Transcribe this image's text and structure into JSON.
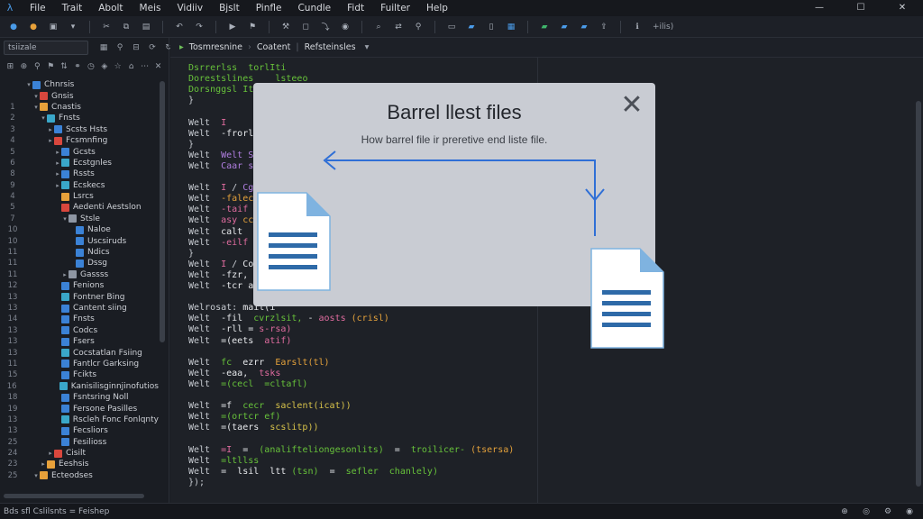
{
  "menu": {
    "app_icon": "lambda-icon",
    "items": [
      "File",
      "Trait",
      "Abolt",
      "Meis",
      "Vidiiv",
      "Bjslt",
      "Pinfle",
      "Cundle",
      "Fidt",
      "Fuilter",
      "Help"
    ],
    "window_controls": [
      "—",
      "☐",
      "✕"
    ]
  },
  "toolbar": {
    "label": "+ilis)"
  },
  "sidebar": {
    "search_value": "tsiizale",
    "tree": [
      {
        "num": "",
        "label": "Chnrsis",
        "icon": "blue",
        "depth": 0,
        "caret": "v"
      },
      {
        "num": "",
        "label": "Gnsis",
        "icon": "red",
        "depth": 1,
        "caret": "v"
      },
      {
        "num": "1",
        "label": "Cnastis",
        "icon": "orange",
        "depth": 1,
        "caret": "v"
      },
      {
        "num": "2",
        "label": "Fnsts",
        "icon": "teal",
        "depth": 2,
        "caret": "v"
      },
      {
        "num": "3",
        "label": "Scsts Hsts",
        "icon": "blue",
        "depth": 3,
        "caret": ">"
      },
      {
        "num": "4",
        "label": "Fcsmnfing",
        "icon": "red",
        "depth": 3,
        "caret": ">"
      },
      {
        "num": "5",
        "label": "Gcsts",
        "icon": "blue",
        "depth": 4,
        "caret": ">"
      },
      {
        "num": "6",
        "label": "Ecstgnles",
        "icon": "teal",
        "depth": 4,
        "caret": ">"
      },
      {
        "num": "8",
        "label": "Rssts",
        "icon": "blue",
        "depth": 4,
        "caret": ">"
      },
      {
        "num": "9",
        "label": "Ecskecs",
        "icon": "teal",
        "depth": 4,
        "caret": ">"
      },
      {
        "num": "4",
        "label": "Lsrcs",
        "icon": "orange",
        "depth": 4,
        "caret": ""
      },
      {
        "num": "5",
        "label": "Aedenti Aestslon",
        "icon": "red",
        "depth": 4,
        "caret": ""
      },
      {
        "num": "7",
        "label": "Stsle",
        "icon": "gray",
        "depth": 5,
        "caret": "v"
      },
      {
        "num": "10",
        "label": "Naloe",
        "icon": "blue",
        "depth": 6,
        "caret": ""
      },
      {
        "num": "10",
        "label": "Uscsiruds",
        "icon": "blue",
        "depth": 6,
        "caret": ""
      },
      {
        "num": "11",
        "label": "Ndics",
        "icon": "blue",
        "depth": 6,
        "caret": ""
      },
      {
        "num": "11",
        "label": "Dssg",
        "icon": "blue",
        "depth": 6,
        "caret": ""
      },
      {
        "num": "11",
        "label": "Gassss",
        "icon": "gray",
        "depth": 5,
        "caret": ">"
      },
      {
        "num": "12",
        "label": "Fenions",
        "icon": "blue",
        "depth": 4,
        "caret": ""
      },
      {
        "num": "13",
        "label": "Fontner Bing",
        "icon": "teal",
        "depth": 4,
        "caret": ""
      },
      {
        "num": "13",
        "label": "Cantent siing",
        "icon": "blue",
        "depth": 4,
        "caret": ""
      },
      {
        "num": "14",
        "label": "Fnsts",
        "icon": "blue",
        "depth": 4,
        "caret": ""
      },
      {
        "num": "13",
        "label": "Codcs",
        "icon": "blue",
        "depth": 4,
        "caret": ""
      },
      {
        "num": "13",
        "label": "Fsers",
        "icon": "blue",
        "depth": 4,
        "caret": ""
      },
      {
        "num": "13",
        "label": "Cocstatlan Fsiing",
        "icon": "teal",
        "depth": 4,
        "caret": ""
      },
      {
        "num": "11",
        "label": "Fantlcr Garksing",
        "icon": "blue",
        "depth": 4,
        "caret": ""
      },
      {
        "num": "15",
        "label": "Fcikts",
        "icon": "blue",
        "depth": 4,
        "caret": ""
      },
      {
        "num": "16",
        "label": "Kanisilisginnjinofutios",
        "icon": "teal",
        "depth": 4,
        "caret": ""
      },
      {
        "num": "18",
        "label": "Fsntsring Noll",
        "icon": "blue",
        "depth": 4,
        "caret": ""
      },
      {
        "num": "19",
        "label": "Fersone Pasilles",
        "icon": "blue",
        "depth": 4,
        "caret": ""
      },
      {
        "num": "13",
        "label": "Rscleh Fonc Fonlqnty",
        "icon": "teal",
        "depth": 4,
        "caret": ""
      },
      {
        "num": "13",
        "label": "Fecsliors",
        "icon": "blue",
        "depth": 4,
        "caret": ""
      },
      {
        "num": "25",
        "label": "Fesilioss",
        "icon": "blue",
        "depth": 4,
        "caret": ""
      },
      {
        "num": "24",
        "label": "Cisilt",
        "icon": "red",
        "depth": 3,
        "caret": ">"
      },
      {
        "num": "23",
        "label": "Eeshsis",
        "icon": "orange",
        "depth": 2,
        "caret": ">"
      },
      {
        "num": "25",
        "label": "Ecteodses",
        "icon": "orange",
        "depth": 1,
        "caret": "v"
      }
    ]
  },
  "editor": {
    "tab_path": [
      "Tosmresnine",
      "Coatent",
      "Refsteinsles"
    ],
    "lines": [
      [
        [
          "c-green",
          "Dsrrerlss  torlIti"
        ]
      ],
      [
        [
          "c-green",
          "Dorestslines"
        ],
        [
          "c-kw",
          "    "
        ],
        [
          "c-green",
          "lsteeo"
        ]
      ],
      [
        [
          "c-green",
          "Dorsnggsl Itfs"
        ]
      ],
      [
        [
          "c-kw",
          "}"
        ]
      ],
      [
        [
          "c-kw",
          ""
        ]
      ],
      [
        [
          "c-kw",
          "Welt  "
        ],
        [
          "c-pink",
          "I"
        ]
      ],
      [
        [
          "c-kw",
          "Welt  "
        ],
        [
          "c-white",
          "-frorl Iif"
        ]
      ],
      [
        [
          "c-kw",
          "}"
        ]
      ],
      [
        [
          "c-kw",
          "Welt  "
        ],
        [
          "c-purple",
          "Welt Stt(Is)"
        ]
      ],
      [
        [
          "c-kw",
          "Welt  "
        ],
        [
          "c-purple",
          "Caar scsht)"
        ]
      ],
      [
        [
          "c-kw",
          ""
        ]
      ],
      [
        [
          "c-kw",
          "Welt  "
        ],
        [
          "c-pink",
          "I"
        ],
        [
          "c-kw",
          " / "
        ],
        [
          "c-purple",
          "Cgrt"
        ]
      ],
      [
        [
          "c-kw",
          "Welt  "
        ],
        [
          "c-orange",
          "-falecre"
        ]
      ],
      [
        [
          "c-kw",
          "Welt  "
        ],
        [
          "c-pink",
          "-taif "
        ],
        [
          "c-orange",
          "Srs"
        ]
      ],
      [
        [
          "c-kw",
          "Welt  "
        ],
        [
          "c-pink",
          "asy "
        ],
        [
          "c-orange",
          "cc"
        ]
      ],
      [
        [
          "c-kw",
          "Welt  "
        ],
        [
          "c-white",
          "calt  cc"
        ]
      ],
      [
        [
          "c-kw",
          "Welt  "
        ],
        [
          "c-pink",
          "-eilf  ca"
        ]
      ],
      [
        [
          "c-kw",
          "}"
        ]
      ],
      [
        [
          "c-kw",
          "Welt  "
        ],
        [
          "c-pink",
          "I"
        ],
        [
          "c-kw",
          " / "
        ],
        [
          "c-white",
          "Cosl"
        ]
      ],
      [
        [
          "c-kw",
          "Welt  "
        ],
        [
          "c-white",
          "-fzr, Cr"
        ]
      ],
      [
        [
          "c-kw",
          "Welt  "
        ],
        [
          "c-white",
          "-tcr anlgsstl, ltatthalty, ralecsetr)"
        ]
      ],
      [
        [
          "c-kw",
          ""
        ]
      ],
      [
        [
          "c-kw",
          "Welrosat: "
        ],
        [
          "c-white",
          "mail(i"
        ]
      ],
      [
        [
          "c-kw",
          "Welt  "
        ],
        [
          "c-white",
          "-fil  "
        ],
        [
          "c-green",
          "cvrzlsit, "
        ],
        [
          "c-white",
          "- "
        ],
        [
          "c-pink",
          "aosts "
        ],
        [
          "c-orange",
          "(crisl)"
        ]
      ],
      [
        [
          "c-kw",
          "Welt  "
        ],
        [
          "c-white",
          "-rll = "
        ],
        [
          "c-pink",
          "s-rsa)"
        ]
      ],
      [
        [
          "c-kw",
          "Welt  "
        ],
        [
          "c-white",
          "=(eets  "
        ],
        [
          "c-pink",
          "atif)"
        ]
      ],
      [
        [
          "c-kw",
          ""
        ]
      ],
      [
        [
          "c-kw",
          "Welt  "
        ],
        [
          "c-green",
          "fc  "
        ],
        [
          "c-white",
          "ezrr  "
        ],
        [
          "c-orange",
          "Earslt(tl)"
        ]
      ],
      [
        [
          "c-kw",
          "Welt  "
        ],
        [
          "c-white",
          "-eaa,  "
        ],
        [
          "c-pink",
          "tsks"
        ]
      ],
      [
        [
          "c-kw",
          "Welt  "
        ],
        [
          "c-green",
          "=(cecl  =cltafl)"
        ]
      ],
      [
        [
          "c-kw",
          ""
        ]
      ],
      [
        [
          "c-kw",
          "Welt  "
        ],
        [
          "c-white",
          "=f  "
        ],
        [
          "c-green",
          "cecr  "
        ],
        [
          "c-yellow",
          "saclent(icat))"
        ]
      ],
      [
        [
          "c-kw",
          "Welt  "
        ],
        [
          "c-green",
          "=(ortcr ef)"
        ]
      ],
      [
        [
          "c-kw",
          "Welt  "
        ],
        [
          "c-white",
          "=(taers  "
        ],
        [
          "c-yellow",
          "scslitp))"
        ]
      ],
      [
        [
          "c-kw",
          ""
        ]
      ],
      [
        [
          "c-kw",
          "Welt  "
        ],
        [
          "c-pink",
          "=I  "
        ],
        [
          "c-white",
          "=  "
        ],
        [
          "c-green",
          "(analifteliongesonlits)  "
        ],
        [
          "c-white",
          "=  "
        ],
        [
          "c-green",
          "troilicer- "
        ],
        [
          "c-orange",
          "(tsersa)"
        ]
      ],
      [
        [
          "c-kw",
          "Welt  "
        ],
        [
          "c-green",
          "=ltllss"
        ]
      ],
      [
        [
          "c-kw",
          "Welt  "
        ],
        [
          "c-white",
          "=  lsil  ltt "
        ],
        [
          "c-green",
          "(tsn)  "
        ],
        [
          "c-white",
          "=  "
        ],
        [
          "c-green",
          "sefler  chanlely)"
        ]
      ],
      [
        [
          "c-kw",
          "});"
        ]
      ]
    ]
  },
  "status": {
    "text": "Bds sfl Cslilsnts = Feishep"
  },
  "dialog": {
    "title": "Barrel llest files",
    "subtitle": "How barrel file ir preretive end liste file.",
    "close": "✕"
  },
  "colors": {
    "accent": "#2f6fd6",
    "dialog_bg": "#c9ccd3",
    "doc_blue": "#2e6aa8",
    "doc_fold": "#7fb3e0"
  }
}
